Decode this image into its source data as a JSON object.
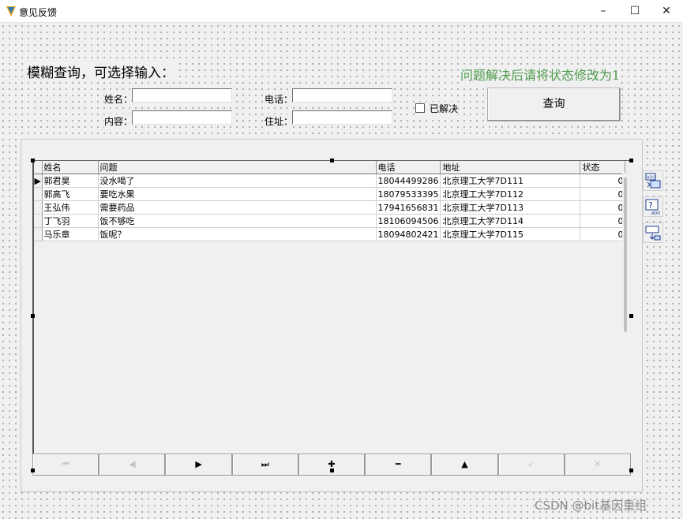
{
  "window": {
    "title": "意见反馈"
  },
  "form": {
    "heading": "模糊查询，可选择输入：",
    "hint": "问题解决后请将状态修改为1",
    "labels": {
      "name": "姓名：",
      "content": "内容：",
      "phone": "电话：",
      "address": "住址："
    },
    "inputs": {
      "name": "",
      "content": "",
      "phone": "",
      "address": ""
    },
    "checkbox_label": "已解决",
    "query_button": "查询"
  },
  "grid": {
    "columns": [
      "姓名",
      "问题",
      "电话",
      "地址",
      "状态"
    ],
    "rows": [
      {
        "name": "郭君昊",
        "issue": "没水喝了",
        "phone": "18044499286",
        "address": "北京理工大学7D111",
        "status": "0"
      },
      {
        "name": "郭高飞",
        "issue": "要吃水果",
        "phone": "18079533395",
        "address": "北京理工大学7D112",
        "status": "0"
      },
      {
        "name": "王弘伟",
        "issue": "需要药品",
        "phone": "17941656831",
        "address": "北京理工大学7D113",
        "status": "0"
      },
      {
        "name": "丁飞羽",
        "issue": "饭不够吃",
        "phone": "18106094506",
        "address": "北京理工大学7D114",
        "status": "0"
      },
      {
        "name": "马乐章",
        "issue": "饭呢？",
        "phone": "18094802421",
        "address": "北京理工大学7D115",
        "status": "0"
      }
    ],
    "current_row_marker": "▶"
  },
  "navigator": {
    "buttons": [
      {
        "name": "first",
        "glyph": "⏮",
        "enabled": false
      },
      {
        "name": "prior",
        "glyph": "◀",
        "enabled": false
      },
      {
        "name": "next",
        "glyph": "▶",
        "enabled": true
      },
      {
        "name": "last",
        "glyph": "⏭",
        "enabled": true
      },
      {
        "name": "insert",
        "glyph": "✚",
        "enabled": true
      },
      {
        "name": "delete",
        "glyph": "━",
        "enabled": true
      },
      {
        "name": "edit",
        "glyph": "▲",
        "enabled": true
      },
      {
        "name": "post",
        "glyph": "✓",
        "enabled": false
      },
      {
        "name": "cancel",
        "glyph": "✕",
        "enabled": false
      }
    ]
  },
  "watermark": "CSDN @bit基因重组",
  "colors": {
    "hint": "#4e9a4e",
    "form_bg": "#f0f0f0"
  }
}
